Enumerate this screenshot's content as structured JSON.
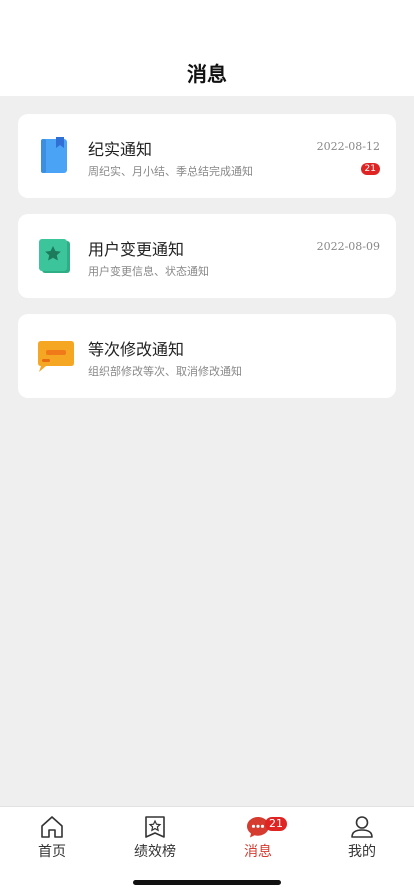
{
  "header": {
    "title": "消息"
  },
  "notifications": [
    {
      "title": "纪实通知",
      "desc": "周纪实、月小结、季总结完成通知",
      "date": "2022-08-12",
      "badge": "21",
      "icon": "book-icon",
      "icon_color": "#4aa3f5"
    },
    {
      "title": "用户变更通知",
      "desc": "用户变更信息、状态通知",
      "date": "2022-08-09",
      "icon": "star-book-icon",
      "icon_color": "#3cc49a"
    },
    {
      "title": "等次修改通知",
      "desc": "组织部修改等次、取消修改通知",
      "icon": "message-icon",
      "icon_color": "#f5a623"
    }
  ],
  "tabbar": {
    "tabs": [
      {
        "label": "首页",
        "icon": "home-icon"
      },
      {
        "label": "绩效榜",
        "icon": "ranking-icon"
      },
      {
        "label": "消息",
        "icon": "chat-icon",
        "badge": "21",
        "active": true
      },
      {
        "label": "我的",
        "icon": "user-icon"
      }
    ]
  },
  "colors": {
    "accent": "#d63b2f",
    "badge": "#e02424",
    "background": "#efefef"
  }
}
